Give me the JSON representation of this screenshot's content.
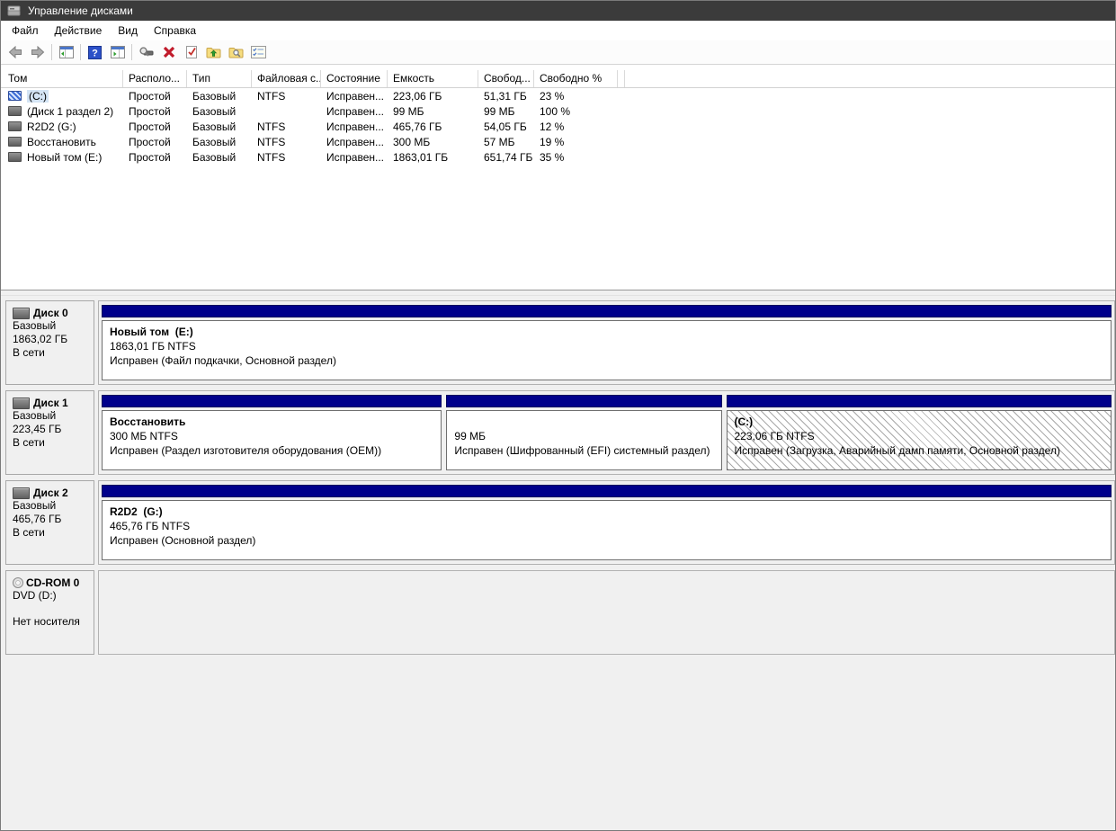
{
  "window": {
    "title": "Управление дисками"
  },
  "menu": {
    "items": [
      {
        "label": "Файл"
      },
      {
        "label": "Действие"
      },
      {
        "label": "Вид"
      },
      {
        "label": "Справка"
      }
    ]
  },
  "toolbar": {
    "buttons": [
      {
        "icon": "back-arrow-icon"
      },
      {
        "icon": "forward-arrow-icon"
      },
      {
        "icon": "show-console-tree-icon"
      },
      {
        "icon": "help-icon"
      },
      {
        "icon": "show-action-pane-icon"
      },
      {
        "icon": "rescan-disks-icon"
      },
      {
        "icon": "delete-volume-icon"
      },
      {
        "icon": "check-document-icon"
      },
      {
        "icon": "folder-up-arrow-icon"
      },
      {
        "icon": "folder-search-icon"
      },
      {
        "icon": "checklist-icon"
      }
    ]
  },
  "volume_table": {
    "columns": [
      {
        "label": "Том",
        "width": 134
      },
      {
        "label": "Располо...",
        "width": 71
      },
      {
        "label": "Тип",
        "width": 72
      },
      {
        "label": "Файловая с...",
        "width": 77
      },
      {
        "label": "Состояние",
        "width": 74
      },
      {
        "label": "Емкость",
        "width": 101
      },
      {
        "label": "Свобод...",
        "width": 62
      },
      {
        "label": "Свободно %",
        "width": 93
      }
    ],
    "rows": [
      {
        "volume": "(C:)",
        "layout": "Простой",
        "type": "Базовый",
        "fs": "NTFS",
        "status": "Исправен...",
        "capacity": "223,06 ГБ",
        "free": "51,31 ГБ",
        "free_pct": "23 %",
        "selected": true
      },
      {
        "volume": "(Диск 1 раздел 2)",
        "layout": "Простой",
        "type": "Базовый",
        "fs": "",
        "status": "Исправен...",
        "capacity": "99 МБ",
        "free": "99 МБ",
        "free_pct": "100 %",
        "selected": false
      },
      {
        "volume": "R2D2 (G:)",
        "layout": "Простой",
        "type": "Базовый",
        "fs": "NTFS",
        "status": "Исправен...",
        "capacity": "465,76 ГБ",
        "free": "54,05 ГБ",
        "free_pct": "12 %",
        "selected": false
      },
      {
        "volume": "Восстановить",
        "layout": "Простой",
        "type": "Базовый",
        "fs": "NTFS",
        "status": "Исправен...",
        "capacity": "300 МБ",
        "free": "57 МБ",
        "free_pct": "19 %",
        "selected": false
      },
      {
        "volume": "Новый том (E:)",
        "layout": "Простой",
        "type": "Базовый",
        "fs": "NTFS",
        "status": "Исправен...",
        "capacity": "1863,01 ГБ",
        "free": "651,74 ГБ",
        "free_pct": "35 %",
        "selected": false
      }
    ]
  },
  "disks": [
    {
      "kind": "disk",
      "name": "Диск 0",
      "type": "Базовый",
      "size": "1863,02 ГБ",
      "status": "В сети",
      "partitions": [
        {
          "name": "Новый том  (E:)",
          "size": "1863,01 ГБ NTFS",
          "status": "Исправен (Файл подкачки, Основной раздел)",
          "width_pct": 100,
          "hatched": false
        }
      ]
    },
    {
      "kind": "disk",
      "name": "Диск 1",
      "type": "Базовый",
      "size": "223,45 ГБ",
      "status": "В сети",
      "partitions": [
        {
          "name": "Восстановить",
          "size": "300 МБ NTFS",
          "status": "Исправен (Раздел изготовителя оборудования (OEM))",
          "width_pct": 34,
          "hatched": false
        },
        {
          "name": "",
          "size": "99 МБ",
          "status": "Исправен (Шифрованный (EFI) системный раздел)",
          "width_pct": 27.5,
          "hatched": false
        },
        {
          "name": "(C:)",
          "size": "223,06 ГБ NTFS",
          "status": "Исправен (Загрузка, Аварийный дамп памяти, Основной раздел)",
          "width_pct": 38.5,
          "hatched": true
        }
      ]
    },
    {
      "kind": "disk",
      "name": "Диск 2",
      "type": "Базовый",
      "size": "465,76 ГБ",
      "status": "В сети",
      "partitions": [
        {
          "name": "R2D2  (G:)",
          "size": "465,76 ГБ NTFS",
          "status": "Исправен (Основной раздел)",
          "width_pct": 100,
          "hatched": false
        }
      ]
    },
    {
      "kind": "cdrom",
      "name": "CD-ROM 0",
      "type": "DVD (D:)",
      "size": "",
      "status": "Нет носителя",
      "partitions": []
    }
  ],
  "colors": {
    "titlebar": "#3b3b3b",
    "partition_bar": "#00008b",
    "panel_bg": "#f0f0f0",
    "selection": "#d4e4f4"
  }
}
